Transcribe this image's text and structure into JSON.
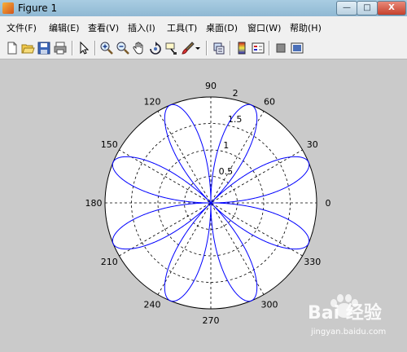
{
  "window": {
    "title": "Figure 1",
    "controls": [
      "—",
      "□",
      "X"
    ]
  },
  "menu": {
    "items": [
      "文件(F)",
      "编辑(E)",
      "查看(V)",
      "插入(I)",
      "工具(T)",
      "桌面(D)",
      "窗口(W)",
      "帮助(H)"
    ]
  },
  "toolbar": {
    "buttons": [
      "new-figure-icon",
      "open-file-icon",
      "save-icon",
      "print-icon",
      "select-arrow-icon",
      "zoom-in-icon",
      "zoom-out-icon",
      "pan-hand-icon",
      "rotate-3d-icon",
      "data-cursor-icon",
      "brush-icon",
      "link-plot-icon",
      "colorbar-icon",
      "legend-icon",
      "hide-plot-tools-icon",
      "show-plot-tools-icon"
    ]
  },
  "chart_data": {
    "type": "polar",
    "curve": "r = 2|sin(4θ)|",
    "theta_ticks": [
      "90",
      "60",
      "30",
      "0",
      "330",
      "300",
      "270",
      "240",
      "210",
      "180",
      "150",
      "120"
    ],
    "r_ticks": [
      "0.5",
      "1",
      "1.5",
      "2"
    ],
    "rlim": [
      0,
      2
    ],
    "series": [
      {
        "color": "#0000ff",
        "petals": 8,
        "max_r": 2
      }
    ],
    "grid": true
  },
  "watermark": {
    "brand": "Bai 经验",
    "url": "jingyan.baidu.com"
  }
}
